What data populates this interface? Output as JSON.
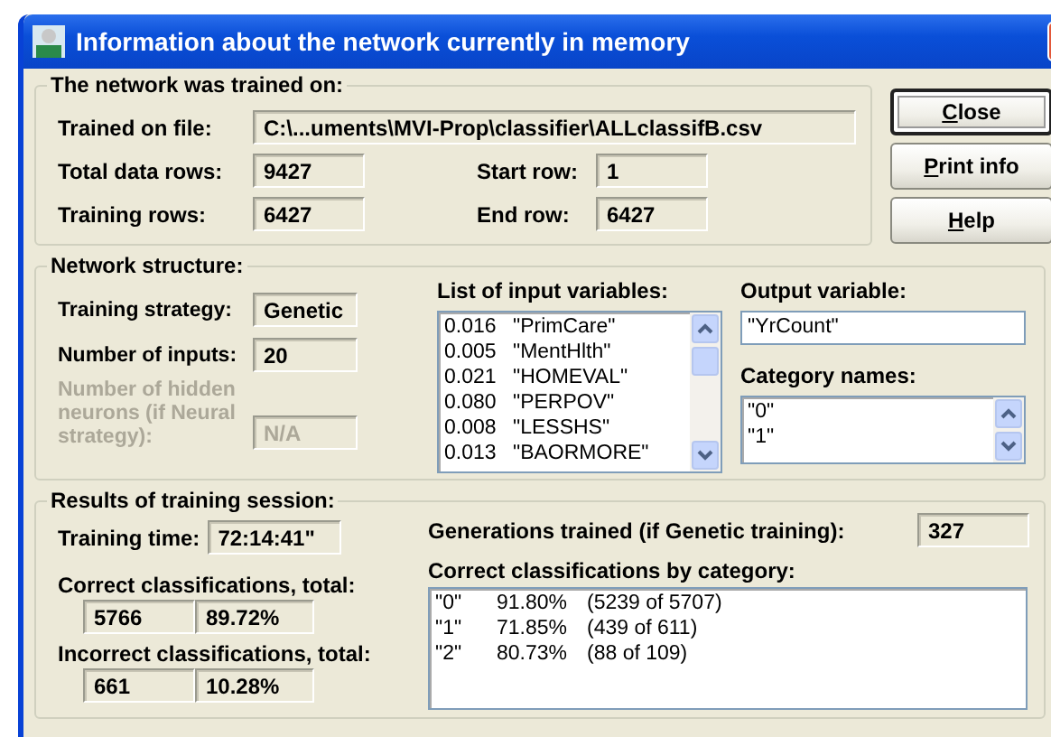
{
  "window": {
    "title": "Information about the network currently in memory"
  },
  "trained_on": {
    "title": "The network was trained on:",
    "file_label": "Trained on file:",
    "file": "C:\\...uments\\MVI-Prop\\classifier\\ALLclassifB.csv",
    "total_rows_label": "Total data rows:",
    "total_rows": "9427",
    "start_row_label": "Start row:",
    "start_row": "1",
    "training_rows_label": "Training rows:",
    "training_rows": "6427",
    "end_row_label": "End row:",
    "end_row": "6427"
  },
  "buttons": [
    {
      "label": "Close",
      "default": true
    },
    {
      "label": "Print info",
      "default": false
    },
    {
      "label": "Help",
      "default": false
    }
  ],
  "structure": {
    "title": "Network structure:",
    "strategy_label": "Training strategy:",
    "strategy": "Genetic",
    "inputs_label": "Number of inputs:",
    "inputs": "20",
    "hidden_label": "Number of hidden neurons (if Neural strategy):",
    "hidden": "N/A",
    "hidden_disabled": true,
    "list_label": "List of input variables:",
    "input_variables": [
      {
        "weight": "0.016",
        "name": "\"PrimCare\""
      },
      {
        "weight": "0.005",
        "name": "\"MentHlth\""
      },
      {
        "weight": "0.021",
        "name": "\"HOMEVAL\""
      },
      {
        "weight": "0.080",
        "name": "\"PERPOV\""
      },
      {
        "weight": "0.008",
        "name": "\"LESSHS\""
      },
      {
        "weight": "0.013",
        "name": "\"BAORMORE\""
      }
    ],
    "output_label": "Output variable:",
    "output": "\"YrCount\"",
    "category_label": "Category names:",
    "categories": [
      "\"0\"",
      "\"1\""
    ]
  },
  "results": {
    "title": "Results of training session:",
    "time_label": "Training time:",
    "time": "72:14:41\"",
    "correct_label": "Correct classifications, total:",
    "correct_count": "5766",
    "correct_pct": "89.72%",
    "incorrect_label": "Incorrect classifications, total:",
    "incorrect_count": "661",
    "incorrect_pct": "10.28%",
    "generations_label": "Generations trained (if Genetic training):",
    "generations": "327",
    "by_category_label": "Correct classifications by category:",
    "by_category": [
      {
        "category": "\"0\"",
        "pct": "91.80%",
        "counts": "(5239 of 5707)"
      },
      {
        "category": "\"1\"",
        "pct": "71.85%",
        "counts": "(439 of 611)"
      },
      {
        "category": "\"2\"",
        "pct": "80.73%",
        "counts": "(88 of 109)"
      }
    ]
  }
}
